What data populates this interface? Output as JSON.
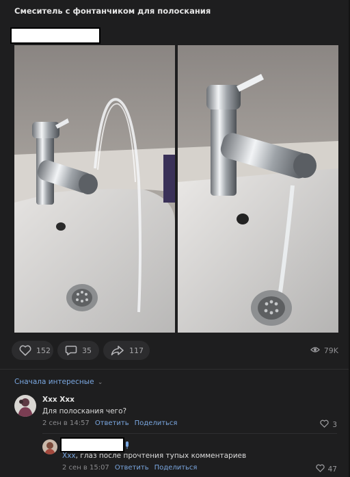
{
  "post": {
    "title": "Смеситель с фонтанчиком для полоскания"
  },
  "actions": {
    "likes": "152",
    "comments": "35",
    "shares": "117",
    "views": "79K"
  },
  "comments": {
    "sort_label": "Сначала интересные",
    "items": [
      {
        "author": "Xxx Xxx",
        "text": "Для полоскания чего?",
        "date": "2 сен в 14:57",
        "reply": "Ответить",
        "share": "Поделиться",
        "likes": "3"
      },
      {
        "author_mention": "Xxx",
        "text": ", глаз после прочтения тупых комментариев",
        "date": "2 сен в 15:07",
        "reply": "Ответить",
        "share": "Поделиться",
        "likes": "47"
      }
    ]
  },
  "icons": {
    "like": "heart-icon",
    "comment": "comment-bubble-icon",
    "share": "share-arrow-icon",
    "views": "eye-icon",
    "sort": "chevron-down-icon"
  },
  "colors": {
    "background": "#1e1e1f",
    "pill": "#2c2c2e",
    "link": "#7aa7e0"
  }
}
